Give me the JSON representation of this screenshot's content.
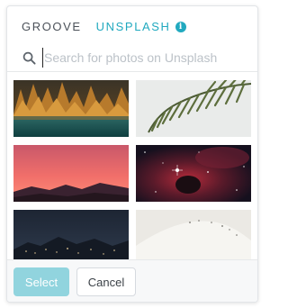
{
  "tabs": {
    "groove": "GROOVE",
    "unsplash": "UNSPLASH",
    "info_glyph": "i",
    "active": "unsplash"
  },
  "search": {
    "value": "",
    "placeholder": "Search for photos on Unsplash",
    "icon": "search-icon"
  },
  "photos": [
    {
      "name": "autumn-forest-lake"
    },
    {
      "name": "palm-leaf"
    },
    {
      "name": "red-sunset-mountains"
    },
    {
      "name": "space-nebula"
    },
    {
      "name": "night-city-lights"
    },
    {
      "name": "snowy-hill"
    }
  ],
  "footer": {
    "select_label": "Select",
    "cancel_label": "Cancel"
  },
  "colors": {
    "accent": "#21a9bf",
    "select_disabled": "#91d4de"
  }
}
